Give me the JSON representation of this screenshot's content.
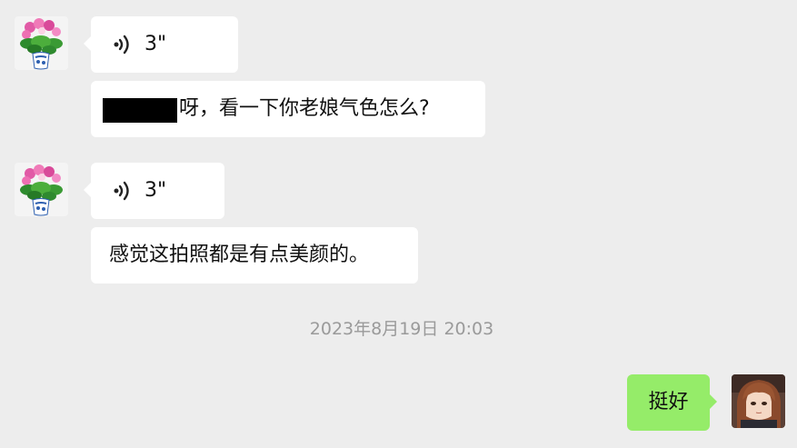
{
  "messages": [
    {
      "type": "voice",
      "sender": "other",
      "duration": "3\""
    },
    {
      "type": "text",
      "sender": "other",
      "redacted": true,
      "text": "呀，看一下你老娘气色怎么?"
    },
    {
      "type": "voice",
      "sender": "other",
      "duration": "3\""
    },
    {
      "type": "text",
      "sender": "other",
      "text": "感觉这拍照都是有点美颜的。"
    },
    {
      "type": "text",
      "sender": "me",
      "text": "挺好"
    }
  ],
  "timestamp": "2023年8月19日 20:03",
  "colors": {
    "background": "#ededed",
    "other_bubble": "#ffffff",
    "my_bubble": "#95ec69",
    "timestamp": "#9a9a9a"
  },
  "icons": {
    "voice": "voice-wave-icon"
  }
}
